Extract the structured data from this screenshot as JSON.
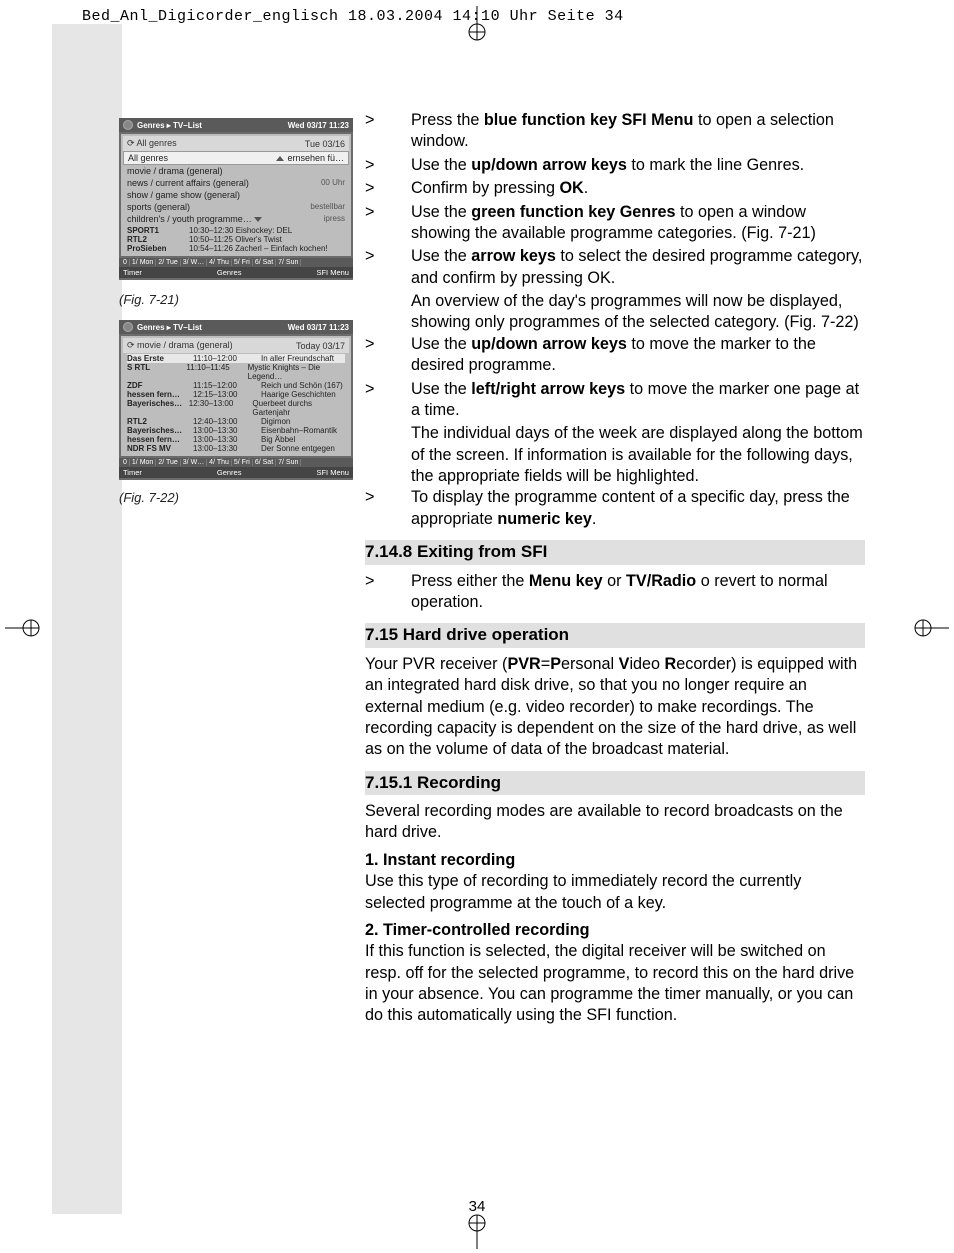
{
  "header_line": "Bed_Anl_Digicorder_englisch  18.03.2004  14:10 Uhr  Seite 34",
  "page_number": "34",
  "fig721": {
    "title_left": "Genres ▸ TV–List",
    "title_right": "Wed 03/17  11:23",
    "date_label": "All genres",
    "date_right": "Tue 03/16",
    "sel_label": "All genres",
    "sel_right1": "ernsehen fü…",
    "rows": [
      {
        "l": "movie / drama (general)",
        "r": ""
      },
      {
        "l": "news / current affairs (general)",
        "r": "00 Uhr"
      },
      {
        "l": "show / game show (general)",
        "r": ""
      },
      {
        "l": "sports (general)",
        "r": "bestellbar"
      },
      {
        "l": "children's / youth programme…",
        "r": "ipress"
      }
    ],
    "prog": [
      {
        "ch": "SPORT1",
        "tm": "10:30–12:30",
        "t": "Eishockey: DEL"
      },
      {
        "ch": "RTL2",
        "tm": "10:50–11:25",
        "t": "Oliver's Twist"
      },
      {
        "ch": "ProSieben",
        "tm": "10:54–11:26",
        "t": "Zacherl – Einfach kochen!"
      }
    ],
    "days": [
      "0",
      "1/ Mon",
      "2/ Tue",
      "3/ W…",
      "4/ Thu",
      "5/ Fri",
      "6/ Sat",
      "7/ Sun"
    ],
    "bottom": {
      "l": "Timer",
      "c": "Genres",
      "r": "SFI Menu"
    },
    "caption": "(Fig. 7-21)"
  },
  "fig722": {
    "title_left": "Genres ▸ TV–List",
    "title_right": "Wed 03/17  11:23",
    "date_label": "movie / drama (general)",
    "date_right": "Today 03/17",
    "prog": [
      {
        "ch": "Das Erste",
        "tm": "11:10–12:00",
        "t": "In aller Freundschaft"
      },
      {
        "ch": "S RTL",
        "tm": "11:10–11:45",
        "t": "Mystic Knights – Die Legend…"
      },
      {
        "ch": "ZDF",
        "tm": "11:15–12:00",
        "t": "Reich und Schön (167)"
      },
      {
        "ch": "hessen fern…",
        "tm": "12:15–13:00",
        "t": "Haarige Geschichten"
      },
      {
        "ch": "Bayerisches…",
        "tm": "12:30–13:00",
        "t": "Querbeet durchs Gartenjahr"
      },
      {
        "ch": "RTL2",
        "tm": "12:40–13:00",
        "t": "Digimon"
      },
      {
        "ch": "Bayerisches…",
        "tm": "13:00–13:30",
        "t": "Eisenbahn–Romantik"
      },
      {
        "ch": "hessen fern…",
        "tm": "13:00–13:30",
        "t": "Big Äbbel"
      },
      {
        "ch": "NDR FS MV",
        "tm": "13:00–13:30",
        "t": "Der Sonne entgegen"
      }
    ],
    "days": [
      "0",
      "1/ Mon",
      "2/ Tue",
      "3/ W…",
      "4/ Thu",
      "5/ Fri",
      "6/ Sat",
      "7/ Sun"
    ],
    "bottom": {
      "l": "Timer",
      "c": "Genres",
      "r": "SFI Menu"
    },
    "caption": "(Fig. 7-22)"
  },
  "steps": {
    "s1a": "Press the ",
    "s1b": "blue function key SFI Menu",
    "s1c": " to open a selection window.",
    "s2a": "Use the ",
    "s2b": "up/down arrow keys",
    "s2c": " to mark the line Genres.",
    "s3a": "Confirm by pressing ",
    "s3b": "OK",
    "s3c": ".",
    "s4a": "Use the ",
    "s4b": "green function key Genres",
    "s4c": " to open a win­dow showing the available programme categories. (Fig. 7-21)",
    "s5a": "Use the ",
    "s5b": "arrow keys",
    "s5c": " to select the desired programme category, and confirm by pressing OK.",
    "s5d": "An overview of the day's programmes will now be displayed, showing only programmes of the selected category. (Fig. 7-22)",
    "s6a": "Use the ",
    "s6b": "up/down arrow keys",
    "s6c": " to move the marker to the desired programme.",
    "s7a": "Use the ",
    "s7b": "left/right arrow keys",
    "s7c": " to move the marker one page at a time.",
    "s7d": "The individual days of the week are displayed along the bottom of the screen. If information is available for the following days, the appropriate fields will be high­lighted.",
    "s8a": "To display the programme content of a specific day, press the appropriate ",
    "s8b": "numeric key",
    "s8c": "."
  },
  "sec1_head": "7.14.8 Exiting from SFI",
  "sec1_s1a": "Press either the ",
  "sec1_s1b": "Menu key",
  "sec1_s1c": " or ",
  "sec1_s1d": "TV/Radio",
  "sec1_s1e": " o revert to normal operation.",
  "sec2_head": "7.15 Hard drive operation",
  "sec2_p1a": "Your PVR receiver (",
  "sec2_p1b": "PVR",
  "sec2_p1c": "=",
  "sec2_p1d": "P",
  "sec2_p1e": "ersonal ",
  "sec2_p1f": "V",
  "sec2_p1g": "ideo ",
  "sec2_p1h": "R",
  "sec2_p1i": "ecorder) is equip­ped with an integrated hard disk drive, so that you no longer require an external medium (e.g. video recorder) to make recordings. The recording capacity is dependent on the size of the hard drive, as well as on the volume of data of the bro­adcast material.",
  "sec3_head": "7.15.1 Recording",
  "sec3_p1": "Several recording modes are available to record broadcasts on the hard drive.",
  "sec3_h1": "1. Instant recording",
  "sec3_p2": "Use this type of recording to immediately record the currently selected programme at the touch of a key.",
  "sec3_h2": "2. Timer-controlled recording",
  "sec3_p3": "If this function is selected, the digital receiver will be switched on resp. off for the selected programme, to record this on the hard drive in your absence. You can programme the timer manually, or you can do this automatically using the SFI func­tion."
}
